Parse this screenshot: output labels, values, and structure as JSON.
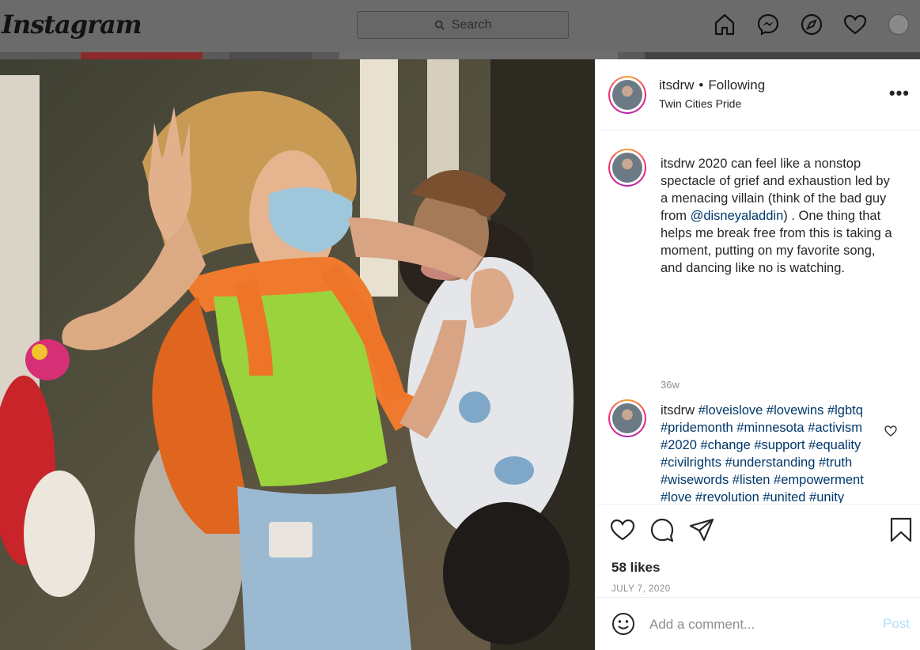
{
  "topbar": {
    "logo": "Instagram",
    "search_placeholder": "Search",
    "icons": [
      "home-icon",
      "messenger-icon",
      "explore-icon",
      "heart-icon",
      "profile-avatar"
    ]
  },
  "post": {
    "author": "itsdrw",
    "follow_sep": "•",
    "follow_status": "Following",
    "location": "Twin Cities Pride",
    "more_label": "•••",
    "caption": {
      "username": "itsdrw",
      "text_before": " 2020 can feel like a nonstop spectacle of grief and exhaustion led by a menacing villain (think of the bad guy from ",
      "mention": "@disneyaladdin",
      "text_after": ") . One thing that helps me break free from this is taking a moment, putting on my favorite song, and dancing like no is watching.",
      "time": "36w"
    },
    "comment": {
      "username": "itsdrw",
      "tags": "#loveislove #lovewins #lgbtq #pridemonth #minnesota #activism #2020 #change #support #equality #civilrights #understanding #truth #wisewords #listen #empowerment #love #revolution #united #unity #solidarity #nojusticenopeace #protest"
    },
    "likes": "58 likes",
    "date": "JULY 7, 2020",
    "comment_placeholder": "Add a comment...",
    "post_button": "Post"
  },
  "colors": {
    "link": "#00376b",
    "post_disabled": "#b2dffc",
    "meta_gray": "#8e8e8e"
  }
}
